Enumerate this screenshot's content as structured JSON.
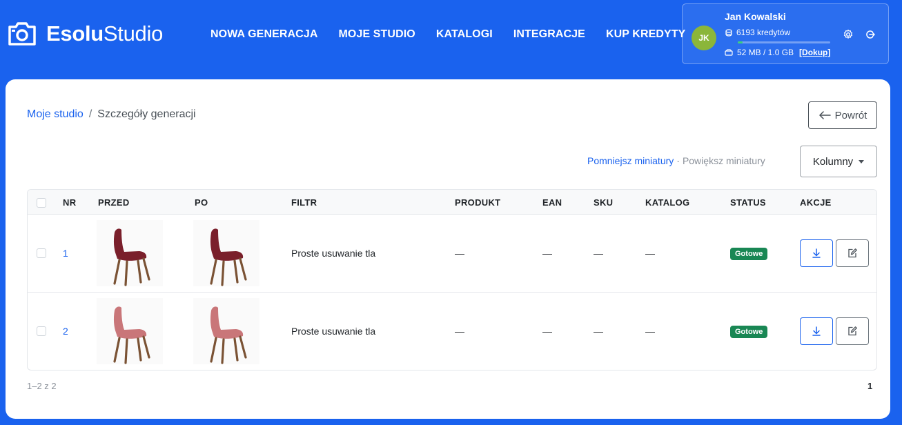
{
  "brand": {
    "bold": "Esolu",
    "light": "Studio",
    "icon": "camera-icon"
  },
  "nav": [
    "NOWA GENERACJA",
    "MOJE STUDIO",
    "KATALOGI",
    "INTEGRACJE",
    "KUP KREDYTY"
  ],
  "user": {
    "initials": "JK",
    "name": "Jan Kowalski",
    "credits": "6193 kredytów",
    "storage": "52 MB / 1.0 GB",
    "topup": "[Dokup]",
    "storage_fraction": 0.05,
    "avatar_color": "#8bb63a"
  },
  "breadcrumb": {
    "parent": "Moje studio",
    "separator": "/",
    "current": "Szczegóły generacji"
  },
  "back_label": "Powrót",
  "thumbs": {
    "smaller": "Pomniejsz miniatury",
    "dot": "·",
    "larger": "Powiększ miniatury"
  },
  "columns_label": "Kolumny",
  "table": {
    "headers": [
      "NR",
      "PRZED",
      "PO",
      "FILTR",
      "PRODUKT",
      "EAN",
      "SKU",
      "KATALOG",
      "STATUS",
      "AKCJE"
    ],
    "rows": [
      {
        "nr": "1",
        "filter": "Proste usuwanie tla",
        "product": "—",
        "ean": "—",
        "sku": "—",
        "catalog": "—",
        "status": "Gotowe",
        "chair_color": "#7a1f2b"
      },
      {
        "nr": "2",
        "filter": "Proste usuwanie tla",
        "product": "—",
        "ean": "—",
        "sku": "—",
        "catalog": "—",
        "status": "Gotowe",
        "chair_color": "#c97679"
      }
    ]
  },
  "pagination": {
    "summary": "1–2 z 2",
    "page": "1"
  },
  "colors": {
    "primary": "#1a62ee",
    "success": "#198754"
  }
}
